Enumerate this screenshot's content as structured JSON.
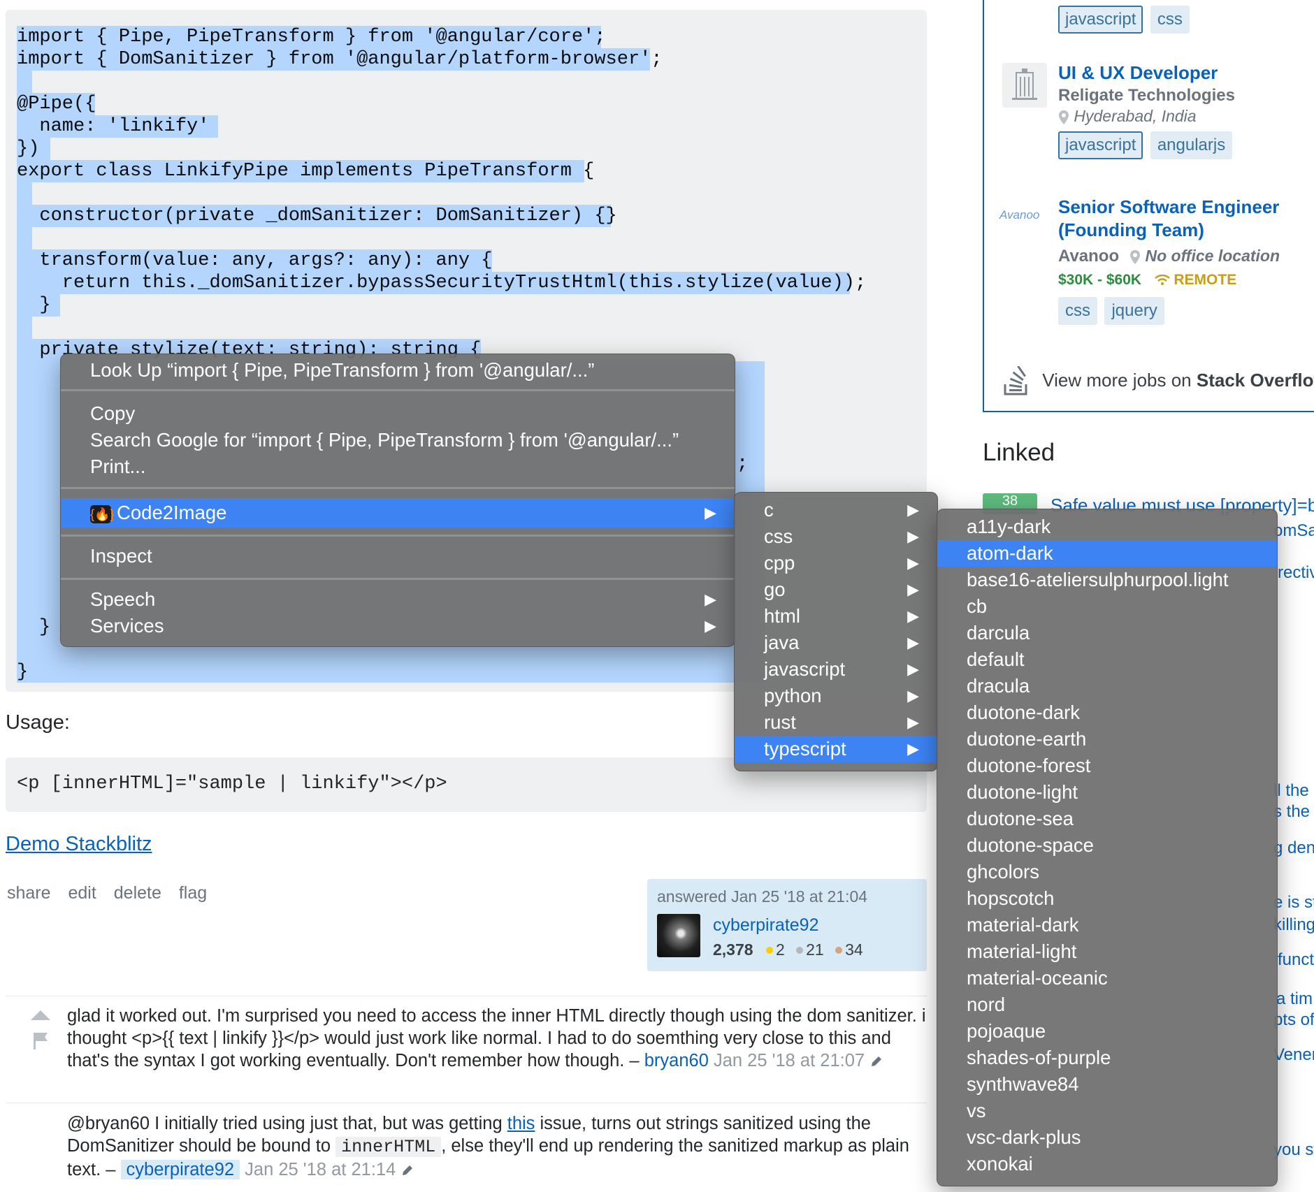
{
  "code": {
    "lines": [
      "import { Pipe, PipeTransform } from '@angular/core';",
      "import { DomSanitizer } from '@angular/platform-browser';",
      "",
      "@Pipe({",
      "  name: 'linkify'",
      "})",
      "export class LinkifyPipe implements PipeTransform {",
      "",
      "  constructor(private _domSanitizer: DomSanitizer) {}",
      "",
      "  transform(value: any, args?: any): any {",
      "    return this._domSanitizer.bypassSecurityTrustHtml(this.stylize(value));",
      "  }",
      "",
      "  private stylize(text: string): string {"
    ],
    "partial_line_tail": ";",
    "closing_inner": "}",
    "closing_outer": "}"
  },
  "usage": {
    "label": "Usage:",
    "code": "<p [innerHTML]=\"sample | linkify\"></p>",
    "demo_link": "Demo Stackblitz"
  },
  "post_menu": [
    "share",
    "edit",
    "delete",
    "flag"
  ],
  "user_card": {
    "answered": "answered Jan 25 '18 at 21:04",
    "name": "cyberpirate92",
    "reputation": "2,378",
    "gold": "2",
    "silver": "21",
    "bronze": "34",
    "colors": {
      "gold": "#ffcc01",
      "silver": "#b4b8bc",
      "bronze": "#d1a684"
    }
  },
  "comments": [
    {
      "text": "glad it worked out. I'm surprised you need to access the inner HTML directly though using the dom sanitizer. i thought <p>{{ text | linkify }}</p> would just work like normal. I had to do soemthing very close to this and that's the syntax I got working eventually. Don't remember how though. –",
      "author": "bryan60",
      "date": "Jan 25 '18 at 21:07"
    },
    {
      "text_before_link": "@bryan60 I initially tried using just that, but was getting",
      "link": "this",
      "text_after_link": "issue, turns out strings sanitized using the DomSanitizer should be bound to",
      "code": "innerHTML",
      "text_end": ", else they'll end up rendering the sanitized markup as plain text. –",
      "author": "cyberpirate92",
      "date": "Jan 25 '18 at 21:14"
    }
  ],
  "jobs": {
    "top_tags": [
      "javascript",
      "css"
    ],
    "items": [
      {
        "title": "UI & UX Developer",
        "company": "Religate Technologies",
        "location": "Hyderabad, India",
        "tags": [
          "javascript",
          "angularjs"
        ]
      },
      {
        "title_line1": "Senior Software Engineer",
        "title_line2": "(Founding Team)",
        "company": "Avanoo",
        "location": "No office location",
        "salary": "$30K - $60K",
        "remote": "REMOTE",
        "tags": [
          "css",
          "jquery"
        ],
        "logo_text": "Avanoo"
      }
    ],
    "view_more_prefix": "View more jobs on",
    "view_more_brand": "Stack Overflow"
  },
  "linked": {
    "heading": "Linked",
    "first_score": "38",
    "first_link": "Safe value must use [property]=b",
    "fragments": [
      "omSa",
      "rectiv",
      "ll the",
      "s the",
      "g den",
      "e is st",
      "killing",
      "funct",
      "a tim",
      "pts of",
      "Venera",
      "you st"
    ]
  },
  "context_menu": {
    "look_up": "Look Up “import { Pipe, PipeTransform } from '@angular/...”",
    "copy": "Copy",
    "search_google": "Search Google for “import { Pipe, PipeTransform } from '@angular/...”",
    "print": "Print...",
    "code2image": "Code2Image",
    "inspect": "Inspect",
    "speech": "Speech",
    "services": "Services",
    "accent": "#3d83f4"
  },
  "languages_menu": [
    "c",
    "css",
    "cpp",
    "go",
    "html",
    "java",
    "javascript",
    "python",
    "rust",
    "typescript"
  ],
  "languages_selected": "typescript",
  "themes_menu": [
    "a11y-dark",
    "atom-dark",
    "base16-ateliersulphurpool.light",
    "cb",
    "darcula",
    "default",
    "dracula",
    "duotone-dark",
    "duotone-earth",
    "duotone-forest",
    "duotone-light",
    "duotone-sea",
    "duotone-space",
    "ghcolors",
    "hopscotch",
    "material-dark",
    "material-light",
    "material-oceanic",
    "nord",
    "pojoaque",
    "shades-of-purple",
    "synthwave84",
    "vs",
    "vsc-dark-plus",
    "xonokai"
  ],
  "themes_selected": "atom-dark"
}
